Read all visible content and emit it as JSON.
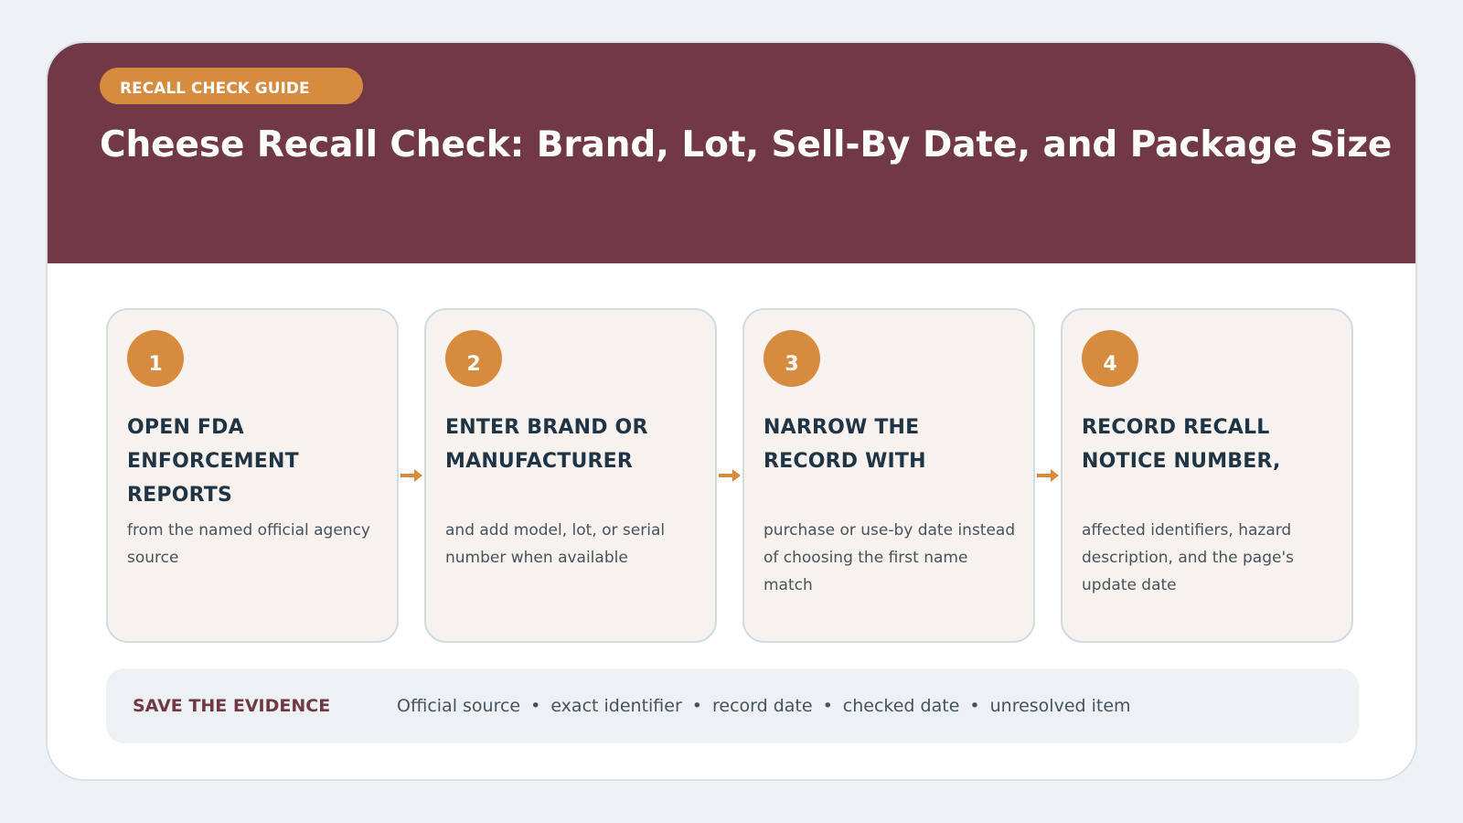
{
  "header": {
    "eyebrow": "RECALL CHECK GUIDE",
    "title": "Cheese Recall Check: Brand, Lot, Sell-By Date, and Package Size"
  },
  "steps": [
    {
      "number": "1",
      "title": "OPEN FDA ENFORCEMENT REPORTS",
      "description": "from the named official agency source"
    },
    {
      "number": "2",
      "title": "ENTER BRAND OR MANUFACTURER",
      "description": "and add model, lot, or serial number when available"
    },
    {
      "number": "3",
      "title": "NARROW THE RECORD WITH",
      "description": "purchase or use-by date instead of choosing the first name match"
    },
    {
      "number": "4",
      "title": "RECORD RECALL NOTICE NUMBER,",
      "description": "affected identifiers, hazard description, and the page's update date"
    }
  ],
  "evidence": {
    "label": "SAVE THE EVIDENCE",
    "items": [
      "Official source",
      "exact identifier",
      "record date",
      "checked date",
      "unresolved item"
    ],
    "separator": "•"
  },
  "colors": {
    "hero": "#713845",
    "accent": "#d78b3f",
    "card": "#f8f2ef",
    "text": "#1f3445"
  },
  "icons": {
    "connector": "arrow-right-icon"
  }
}
